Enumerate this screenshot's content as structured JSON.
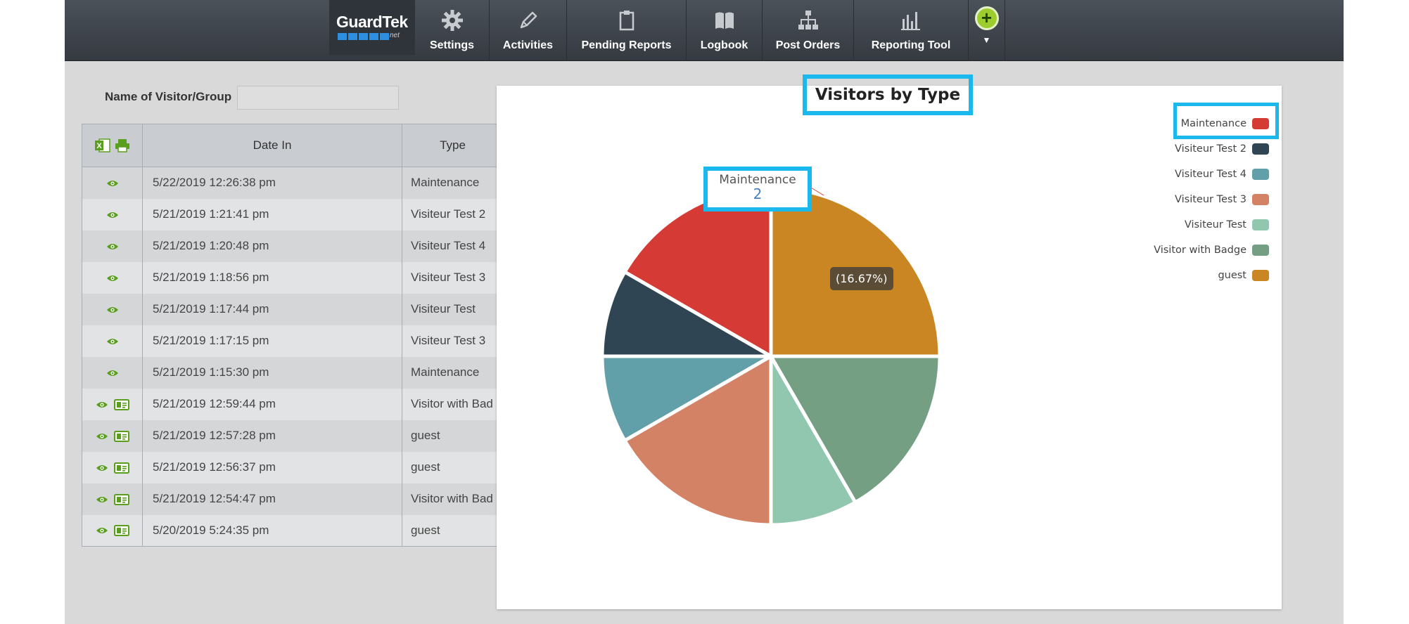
{
  "nav": {
    "logo_word": "GuardTek",
    "logo_suffix": "net",
    "items": [
      {
        "label": "Settings",
        "icon": "gear-icon"
      },
      {
        "label": "Activities",
        "icon": "pencil-icon"
      },
      {
        "label": "Pending Reports",
        "icon": "clipboard-icon"
      },
      {
        "label": "Logbook",
        "icon": "book-icon"
      },
      {
        "label": "Post Orders",
        "icon": "org-chart-icon"
      },
      {
        "label": "Reporting Tool",
        "icon": "bar-chart-icon"
      }
    ],
    "add_button": "+",
    "add_menu_caret": "▼"
  },
  "filter": {
    "label": "Name of Visitor/Group",
    "value": ""
  },
  "table": {
    "columns": [
      "",
      "Date In",
      "Type"
    ],
    "rows": [
      {
        "date": "5/22/2019 12:26:38 pm",
        "type": "Maintenance",
        "badge": false
      },
      {
        "date": "5/21/2019 1:21:41 pm",
        "type": "Visiteur Test 2",
        "badge": false
      },
      {
        "date": "5/21/2019 1:20:48 pm",
        "type": "Visiteur Test 4",
        "badge": false
      },
      {
        "date": "5/21/2019 1:18:56 pm",
        "type": "Visiteur Test 3",
        "badge": false
      },
      {
        "date": "5/21/2019 1:17:44 pm",
        "type": "Visiteur Test",
        "badge": false
      },
      {
        "date": "5/21/2019 1:17:15 pm",
        "type": "Visiteur Test 3",
        "badge": false
      },
      {
        "date": "5/21/2019 1:15:30 pm",
        "type": "Maintenance",
        "badge": false
      },
      {
        "date": "5/21/2019 12:59:44 pm",
        "type": "Visitor with Bad",
        "badge": true
      },
      {
        "date": "5/21/2019 12:57:28 pm",
        "type": "guest",
        "badge": true
      },
      {
        "date": "5/21/2019 12:56:37 pm",
        "type": "guest",
        "badge": true
      },
      {
        "date": "5/21/2019 12:54:47 pm",
        "type": "Visitor with Bad",
        "badge": true
      },
      {
        "date": "5/20/2019 5:24:35 pm",
        "type": "guest",
        "badge": true
      }
    ]
  },
  "colors": {
    "icon_green": "#5a9e1e",
    "highlight": "#1ab8ec"
  },
  "chart_data": {
    "type": "pie",
    "title": "Visitors by Type",
    "categories": [
      "Maintenance",
      "Visiteur Test 2",
      "Visiteur Test 4",
      "Visiteur Test 3",
      "Visiteur Test",
      "Visitor with Badge",
      "guest"
    ],
    "values": [
      2,
      1,
      1,
      2,
      1,
      2,
      3
    ],
    "colors": [
      "#d63a35",
      "#2f4554",
      "#61a0a8",
      "#d48265",
      "#91c7ae",
      "#749f83",
      "#ca8622"
    ],
    "legend_position": "top-right",
    "tooltip": {
      "category": "Maintenance",
      "value": 2,
      "percent": "(16.67%)"
    }
  }
}
